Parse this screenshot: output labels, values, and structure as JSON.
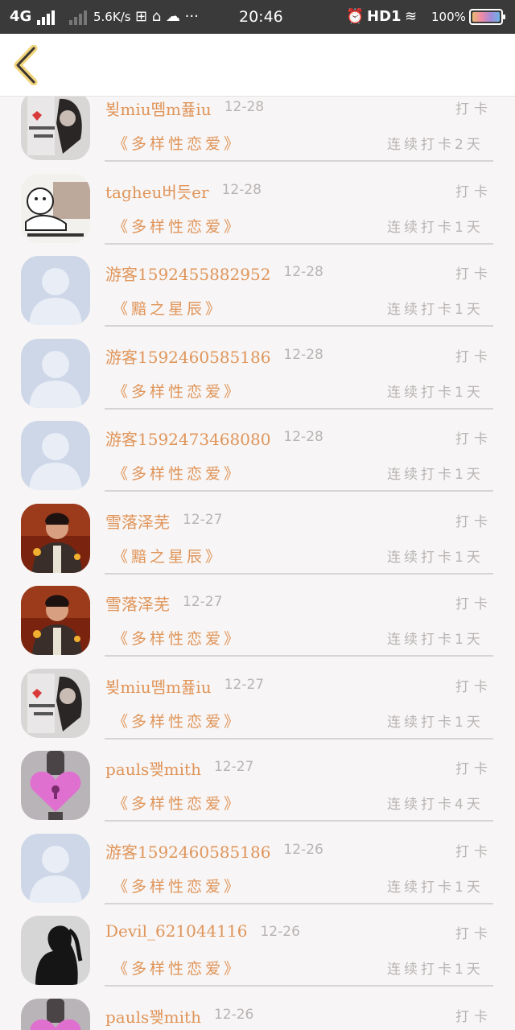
{
  "status_bar": {
    "network": "4G",
    "speed": "5.6K/s",
    "time": "20:46",
    "hd": "HD1",
    "battery": "100%",
    "battery_level": 1.0
  },
  "header": {
    "back_icon": "chevron-left-icon"
  },
  "colors": {
    "accent": "#e0955a",
    "muted": "#b9b4b4",
    "divider": "#d8d4d4",
    "background": "#f7f5f5"
  },
  "checkin_label": "打卡",
  "entries": [
    {
      "name": "뵞miu뗌m퓶iu",
      "date": "12-28",
      "book": "《多样性恋爱》",
      "streak": "连续打卡2天",
      "avatar": "meme-girl"
    },
    {
      "name": "tagheu버듯er",
      "date": "12-28",
      "book": "《多样性恋爱》",
      "streak": "连续打卡1天",
      "avatar": "cartoon"
    },
    {
      "name": "游客1592455882952",
      "date": "12-28",
      "book": "《黯之星辰》",
      "streak": "连续打卡1天",
      "avatar": "default"
    },
    {
      "name": "游客1592460585186",
      "date": "12-28",
      "book": "《多样性恋爱》",
      "streak": "连续打卡1天",
      "avatar": "default"
    },
    {
      "name": "游客1592473468080",
      "date": "12-28",
      "book": "《多样性恋爱》",
      "streak": "连续打卡1天",
      "avatar": "default"
    },
    {
      "name": "雪落泽芜",
      "date": "12-27",
      "book": "《黯之星辰》",
      "streak": "连续打卡1天",
      "avatar": "photo"
    },
    {
      "name": "雪落泽芜",
      "date": "12-27",
      "book": "《多样性恋爱》",
      "streak": "连续打卡1天",
      "avatar": "photo"
    },
    {
      "name": "뵞miu뗌m퓶iu",
      "date": "12-27",
      "book": "《多样性恋爱》",
      "streak": "连续打卡1天",
      "avatar": "meme-girl"
    },
    {
      "name": "pauls꽺mith",
      "date": "12-27",
      "book": "《多样性恋爱》",
      "streak": "连续打卡4天",
      "avatar": "heart-lock"
    },
    {
      "name": "游客1592460585186",
      "date": "12-26",
      "book": "《多样性恋爱》",
      "streak": "连续打卡1天",
      "avatar": "default"
    },
    {
      "name": "Devil_621044116",
      "date": "12-26",
      "book": "《多样性恋爱》",
      "streak": "连续打卡1天",
      "avatar": "silhouette"
    },
    {
      "name": "pauls꽺mith",
      "date": "12-26",
      "book": "",
      "streak": "",
      "avatar": "heart-lock"
    }
  ]
}
